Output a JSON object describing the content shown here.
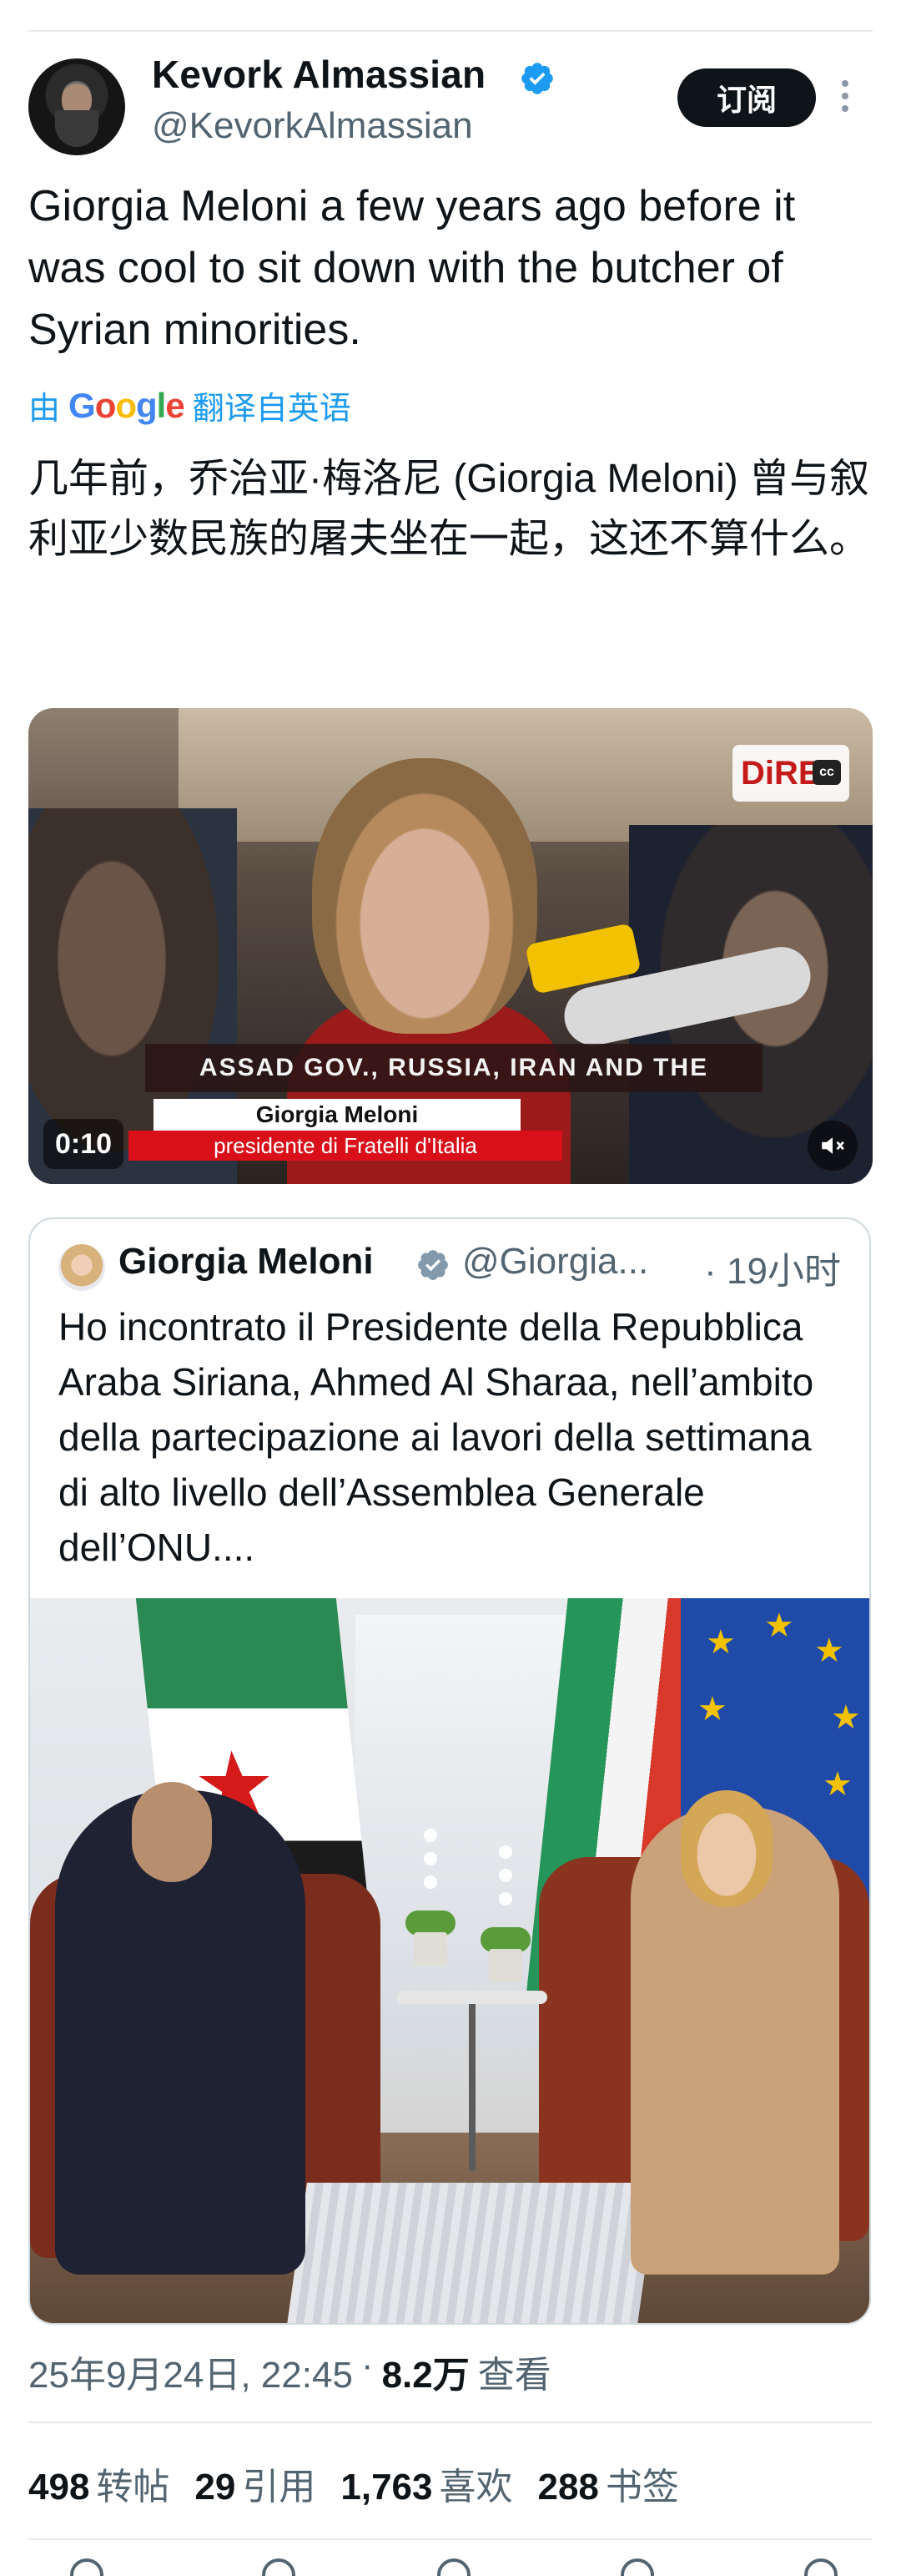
{
  "author": {
    "name": "Kevork Almassian",
    "handle": "@KevorkAlmassian",
    "follow_label": "订阅"
  },
  "tweet": {
    "text": "Giorgia Meloni a few years ago before it was cool to sit down with the butcher of Syrian minorities.",
    "translate_prefix": "由",
    "translate_suffix": "翻译自英语",
    "translated_text": "几年前，乔治亚·梅洛尼 (Giorgia Meloni) 曾与叙利亚少数民族的屠夫坐在一起，这还不算什么。"
  },
  "video": {
    "duration": "0:10",
    "caption": "ASSAD GOV., RUSSIA, IRAN AND THE",
    "lower_third_name": "Giorgia Meloni",
    "lower_third_title": "presidente di Fratelli d'Italia",
    "channel_logo": "DiRE",
    "cc_label": "cc"
  },
  "quote": {
    "name": "Giorgia Meloni",
    "handle": "@Giorgia...",
    "time": "· 19小时",
    "text": "Ho incontrato il Presidente della Repubblica Araba Siriana, Ahmed Al Sharaa, nell’ambito della partecipazione ai lavori della settimana di alto livello dell’Assemblea Generale dell’ONU...."
  },
  "meta": {
    "timestamp": "25年9月24日, 22:45",
    "separator": "·",
    "views_count": "8.2万",
    "views_label": "查看"
  },
  "stats": [
    {
      "count": "498",
      "label": "转帖"
    },
    {
      "count": "29",
      "label": "引用"
    },
    {
      "count": "1,763",
      "label": "喜欢"
    },
    {
      "count": "288",
      "label": "书签"
    }
  ],
  "colors": {
    "link_blue": "#1d9bf0",
    "verified_blue": "#1d9bf0",
    "verified_gray": "#829aab",
    "text": "#0f1419",
    "muted": "#536471"
  },
  "icons": [
    "verified-badge-icon",
    "more-options-icon",
    "google-logo",
    "mute-icon"
  ]
}
